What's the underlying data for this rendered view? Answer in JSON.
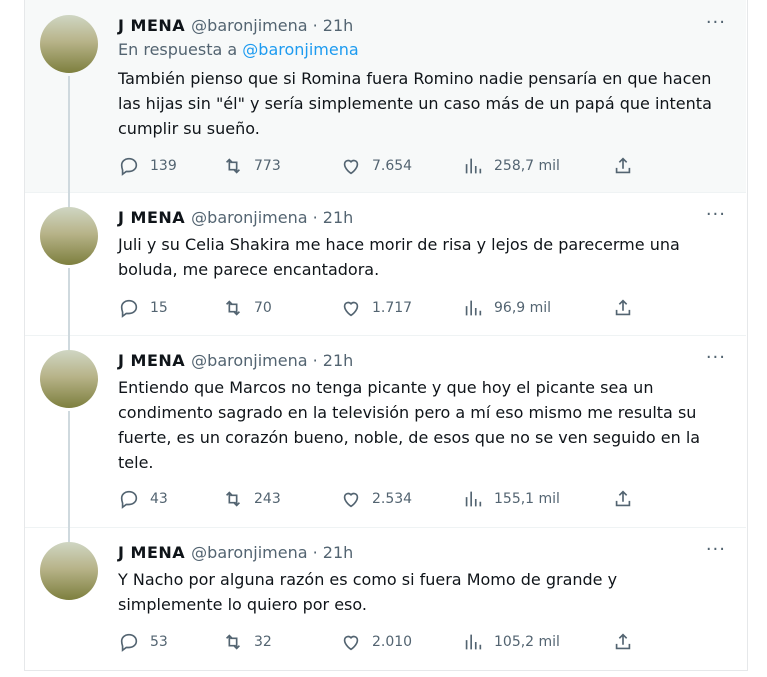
{
  "tweets": [
    {
      "name": "J MENA",
      "handle": "@baronjimena · 21h",
      "reply_prefix": "En respuesta a",
      "reply_handle": "@baronjimena",
      "text": "También pienso que si Romina fuera Romino nadie pensaría en que hacen las hijas sin \"él\" y sería simplemente un caso más de un papá que intenta cumplir su sueño.",
      "replies": "139",
      "retweets": "773",
      "likes": "7.654",
      "views": "258,7 mil"
    },
    {
      "name": "J MENA",
      "handle": "@baronjimena · 21h",
      "text": "Juli y su Celia Shakira me hace morir de risa y lejos de parecerme una boluda, me parece encantadora.",
      "replies": "15",
      "retweets": "70",
      "likes": "1.717",
      "views": "96,9 mil"
    },
    {
      "name": "J MENA",
      "handle": "@baronjimena · 21h",
      "text": "Entiendo que Marcos no tenga picante y que hoy el picante sea un condimento sagrado en la televisión pero a mí eso mismo me resulta su fuerte, es un corazón bueno, noble, de esos que no se ven seguido en la tele.",
      "replies": "43",
      "retweets": "243",
      "likes": "2.534",
      "views": "155,1 mil"
    },
    {
      "name": "J MENA",
      "handle": "@baronjimena · 21h",
      "text": "Y Nacho por alguna razón es como si fuera Momo de grande y simplemente lo quiero por eso.",
      "replies": "53",
      "retweets": "32",
      "likes": "2.010",
      "views": "105,2 mil"
    }
  ],
  "more_glyph": "···",
  "colors": {
    "text": "#0f1419",
    "secondary": "#536471",
    "link": "#1d9bf0",
    "thread_line": "#cfd9de",
    "highlight_bg": "#f7f9f9"
  }
}
